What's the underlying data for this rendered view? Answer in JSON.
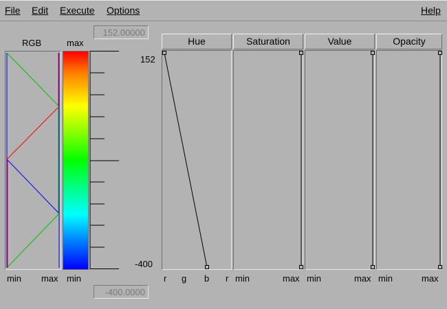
{
  "menu": {
    "file": "File",
    "edit": "Edit",
    "execute": "Execute",
    "options": "Options",
    "help": "Help"
  },
  "range": {
    "max_value": "152.00000",
    "min_value": "-400.0000",
    "max_label": "152",
    "min_label": "-400"
  },
  "colormap": {
    "rgb_label": "RGB",
    "max_label": "max",
    "min_left": "min",
    "max_bottom": "max",
    "min_bar": "min"
  },
  "channels": [
    {
      "label": "Hue",
      "bottom_labels": [
        "r",
        "g",
        "b",
        "r"
      ]
    },
    {
      "label": "Saturation",
      "bottom_min": "min",
      "bottom_max": "max"
    },
    {
      "label": "Value",
      "bottom_min": "min",
      "bottom_max": "max"
    },
    {
      "label": "Opacity",
      "bottom_min": "min",
      "bottom_max": "max"
    }
  ],
  "colors": {
    "background": "#b3b3b3",
    "red": "#ff0000",
    "green": "#00c000",
    "blue": "#0000ff"
  }
}
